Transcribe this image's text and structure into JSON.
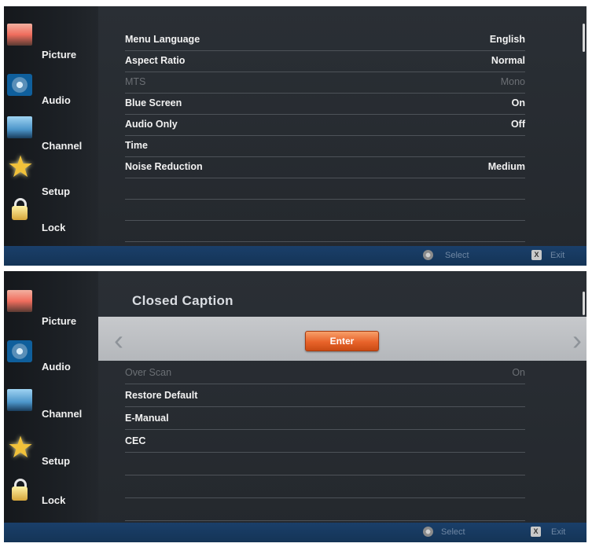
{
  "screen1": {
    "sidebar": [
      {
        "key": "picture",
        "label": "Picture",
        "icon": "picture-icon"
      },
      {
        "key": "audio",
        "label": "Audio",
        "icon": "speaker-icon"
      },
      {
        "key": "channel",
        "label": "Channel",
        "icon": "satellite-dish-icon"
      },
      {
        "key": "setup",
        "label": "Setup",
        "icon": "star-icon"
      },
      {
        "key": "lock",
        "label": "Lock",
        "icon": "padlock-icon"
      }
    ],
    "rows": [
      {
        "label": "Menu Language",
        "value": "English",
        "enabled": true
      },
      {
        "label": "Aspect Ratio",
        "value": "Normal",
        "enabled": true
      },
      {
        "label": "MTS",
        "value": "Mono",
        "enabled": false
      },
      {
        "label": "Blue Screen",
        "value": "On",
        "enabled": true
      },
      {
        "label": "Audio Only",
        "value": "Off",
        "enabled": true
      },
      {
        "label": "Time",
        "value": "",
        "enabled": true
      },
      {
        "label": "Noise Reduction",
        "value": "Medium",
        "enabled": true
      }
    ],
    "footer": {
      "select_label": "Select",
      "exit_label": "Exit",
      "exit_key": "X"
    }
  },
  "screen2": {
    "sidebar": [
      {
        "key": "picture",
        "label": "Picture",
        "icon": "picture-icon"
      },
      {
        "key": "audio",
        "label": "Audio",
        "icon": "speaker-icon"
      },
      {
        "key": "channel",
        "label": "Channel",
        "icon": "satellite-dish-icon"
      },
      {
        "key": "setup",
        "label": "Setup",
        "icon": "star-icon"
      },
      {
        "key": "lock",
        "label": "Lock",
        "icon": "padlock-icon"
      }
    ],
    "section_title": "Closed Caption",
    "enter_label": "Enter",
    "arrow_left": "‹",
    "arrow_right": "›",
    "rows": [
      {
        "label": "Over Scan",
        "value": "On",
        "enabled": false
      },
      {
        "label": "Restore Default",
        "value": "",
        "enabled": true
      },
      {
        "label": "E-Manual",
        "value": "",
        "enabled": true
      },
      {
        "label": "CEC",
        "value": "",
        "enabled": true
      }
    ],
    "footer": {
      "select_label": "Select",
      "exit_label": "Exit",
      "exit_key": "X"
    }
  },
  "colors": {
    "accent_orange": "#e8632a",
    "footer_blue": "#143456",
    "setup_star": "#f2c23a"
  }
}
